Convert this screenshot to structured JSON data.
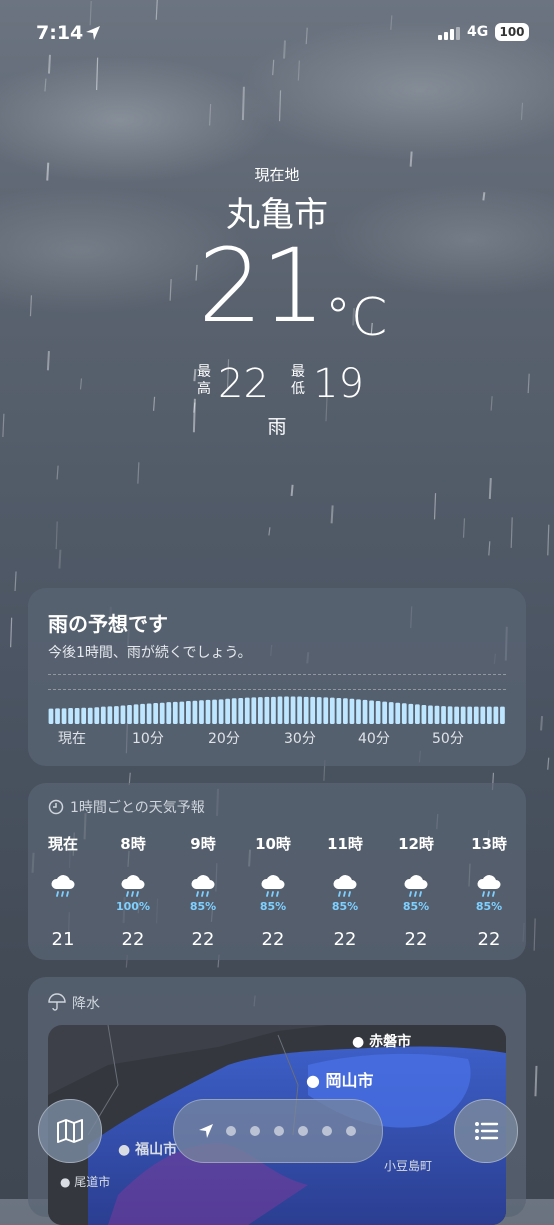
{
  "status_bar": {
    "time": "7:14",
    "network": "4G",
    "battery": "100"
  },
  "current": {
    "location_label": "現在地",
    "city": "丸亀市",
    "temperature": "21",
    "unit": "°C",
    "high_label": "最高",
    "high": "22",
    "low_label": "最低",
    "low": "19",
    "condition": "雨"
  },
  "precip_card": {
    "title": "雨の予想です",
    "subtitle": "今後1時間、雨が続くでしょう。",
    "ticks": [
      "現在",
      "10分",
      "20分",
      "30分",
      "40分",
      "50分"
    ],
    "intensity": [
      0.55,
      0.56,
      0.56,
      0.57,
      0.57,
      0.58,
      0.58,
      0.6,
      0.62,
      0.63,
      0.64,
      0.66,
      0.68,
      0.7,
      0.72,
      0.73,
      0.75,
      0.76,
      0.78,
      0.79,
      0.8,
      0.82,
      0.83,
      0.85,
      0.86,
      0.87,
      0.88,
      0.9,
      0.92,
      0.93,
      0.94,
      0.95,
      0.96,
      0.97,
      0.97,
      0.98,
      0.98,
      0.98,
      0.98,
      0.97,
      0.97,
      0.96,
      0.95,
      0.94,
      0.93,
      0.92,
      0.9,
      0.88,
      0.86,
      0.84,
      0.82,
      0.8,
      0.78,
      0.76,
      0.74,
      0.72,
      0.7,
      0.68,
      0.66,
      0.65,
      0.64,
      0.63,
      0.62,
      0.62,
      0.62,
      0.62,
      0.62,
      0.62,
      0.62,
      0.62
    ]
  },
  "hourly": {
    "header": "1時間ごとの天気予報",
    "items": [
      {
        "time": "現在",
        "icon": "cloud-rain-icon",
        "pop": "",
        "temp": "21"
      },
      {
        "time": "8時",
        "icon": "cloud-rain-icon",
        "pop": "100%",
        "temp": "22"
      },
      {
        "time": "9時",
        "icon": "cloud-rain-icon",
        "pop": "85%",
        "temp": "22"
      },
      {
        "time": "10時",
        "icon": "cloud-rain-icon",
        "pop": "85%",
        "temp": "22"
      },
      {
        "time": "11時",
        "icon": "cloud-rain-icon",
        "pop": "85%",
        "temp": "22"
      },
      {
        "time": "12時",
        "icon": "cloud-rain-icon",
        "pop": "85%",
        "temp": "22"
      },
      {
        "time": "13時",
        "icon": "cloud-rain-icon",
        "pop": "85%",
        "temp": "22"
      }
    ]
  },
  "precip_map": {
    "header": "降水",
    "places": {
      "akaiwa": "赤磐市",
      "okayama": "岡山市",
      "fukuyama": "福山市",
      "onomichi": "尾道市",
      "shodoshima": "小豆島町"
    }
  },
  "bottom_bar": {
    "page_count": 7,
    "current_page": 0
  }
}
